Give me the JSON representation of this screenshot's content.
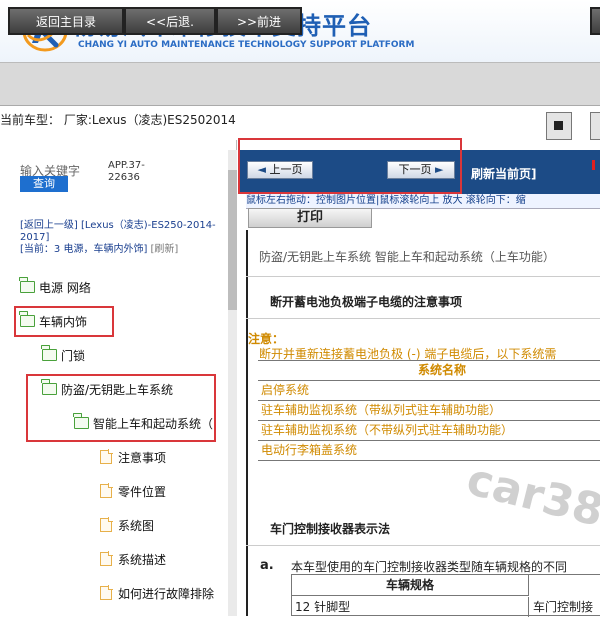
{
  "header": {
    "title": "畅易汽车维修技术支持平台",
    "subtitle": "CHANG YI AUTO MAINTENANCE TECHNOLOGY SUPPORT PLATFORM"
  },
  "toolbar": {
    "home": "返回主目录",
    "back": "<<后退.",
    "forward": ">>前进"
  },
  "vehicle_bar": {
    "text": "当前车型：  厂家:Lexus（凌志)ES2502014"
  },
  "sidebar": {
    "keyword_placeholder": "输入关键字",
    "search_button": "查询",
    "app_code": "APP.37-22636",
    "link_back": "[返回上一级]",
    "link_model": "[Lexus（凌志)-ES250-2014-2017]",
    "link_current": "[当前：3 电源，车辆内外饰]",
    "link_refresh": "[刷新]",
    "tree": [
      {
        "label": "电源 网络",
        "type": "folder"
      },
      {
        "label": "车辆内饰",
        "type": "folder"
      },
      {
        "label": "门锁",
        "type": "folder"
      },
      {
        "label": "防盗/无钥匙上车系统",
        "type": "folder"
      },
      {
        "label": "智能上车和起动系统（",
        "type": "folder"
      },
      {
        "label": "注意事项",
        "type": "page"
      },
      {
        "label": "零件位置",
        "type": "page"
      },
      {
        "label": "系统图",
        "type": "page"
      },
      {
        "label": "系统描述",
        "type": "page"
      },
      {
        "label": "如何进行故障排除",
        "type": "page"
      }
    ]
  },
  "viewer": {
    "prev": "上一页",
    "next": "下一页",
    "refresh": "刷新当前页]",
    "hint": "鼠标左右拖动：控制图片位置|鼠标滚轮向上 放大  滚轮向下：缩",
    "print": "打印",
    "doc_title": "防盗/无钥匙上车系统  智能上车和起动系统（上车功能）",
    "section1": "断开蓄电池负极端子电缆的注意事项",
    "note_label": "注意：",
    "note_text": "断开并重新连接蓄电池负极 (-) 端子电缆后，以下系统需",
    "table": {
      "header": "系统名称",
      "rows": [
        "启停系统",
        "驻车辅助监视系统（带纵列式驻车辅助功能）",
        "驻车辅助监视系统（不带纵列式驻车辅助功能）",
        "电动行李箱盖系统"
      ]
    },
    "watermark": "car38",
    "section2": "车门控制接收器表示法",
    "item_a_label": "a.",
    "item_a_text": "本车型使用的车门控制接收器类型随车辆规格的不同",
    "table2": {
      "header": "车辆规格",
      "cell1": "12 针脚型",
      "cell2": "车门控制接"
    }
  },
  "colors": {
    "brand_blue": "#1f5fb4",
    "nav_bar": "#1c4b86",
    "highlight_red": "#d9363a",
    "note_orange": "#d08a00",
    "folder_green": "#49a13b"
  }
}
